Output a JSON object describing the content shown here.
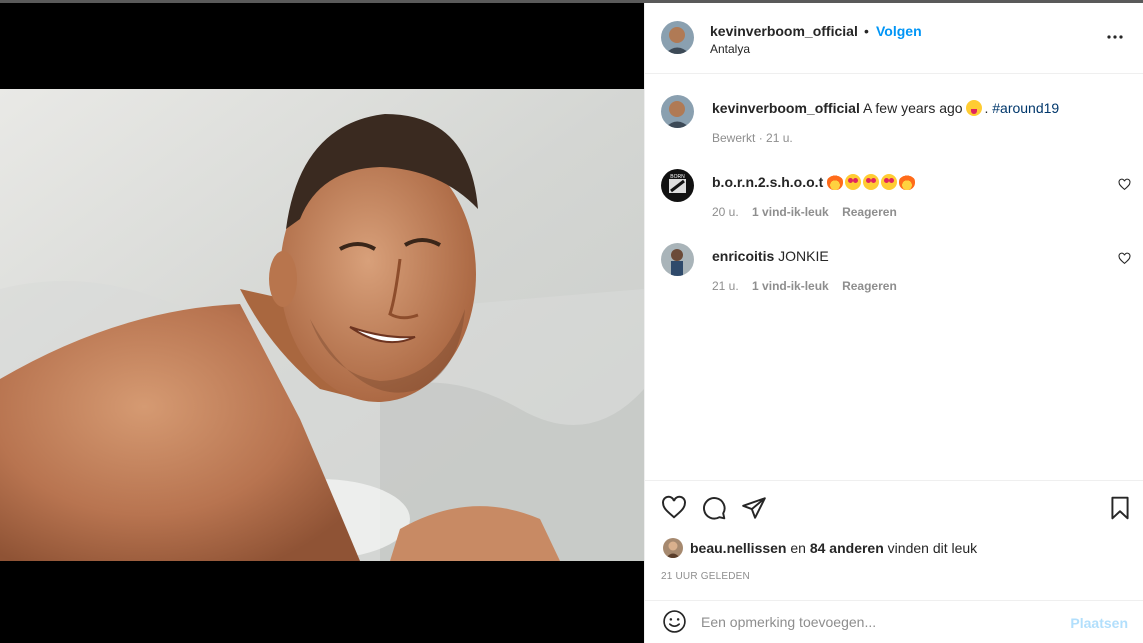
{
  "post": {
    "username": "kevinverboom_official",
    "follow_label": "Volgen",
    "separator": "•",
    "location": "Antalya"
  },
  "caption": {
    "username": "kevinverboom_official",
    "text": "A few years ago",
    "after_emoji": ".",
    "hashtag": "#around19",
    "edited": "Bewerkt",
    "time": "21 u."
  },
  "comments": [
    {
      "username": "b.o.r.n.2.s.h.o.o.t",
      "text": "",
      "emojis": [
        "fire",
        "heart-eyes",
        "heart-eyes",
        "heart-eyes",
        "fire"
      ],
      "time": "20 u.",
      "likes": "1 vind-ik-leuk",
      "reply": "Reageren"
    },
    {
      "username": "enricoitis",
      "text": "JONKIE",
      "emojis": [],
      "time": "21 u.",
      "likes": "1 vind-ik-leuk",
      "reply": "Reageren"
    }
  ],
  "likes": {
    "user": "beau.nellissen",
    "and": "en",
    "others": "84 anderen",
    "suffix": "vinden dit leuk"
  },
  "timestamp": "21 UUR GELEDEN",
  "add_comment": {
    "placeholder": "Een opmerking toevoegen...",
    "post_label": "Plaatsen"
  },
  "colors": {
    "accent": "#0095f6",
    "hashtag": "#00376b",
    "muted": "#8e8e8e",
    "post_disabled": "#b2dffc"
  }
}
